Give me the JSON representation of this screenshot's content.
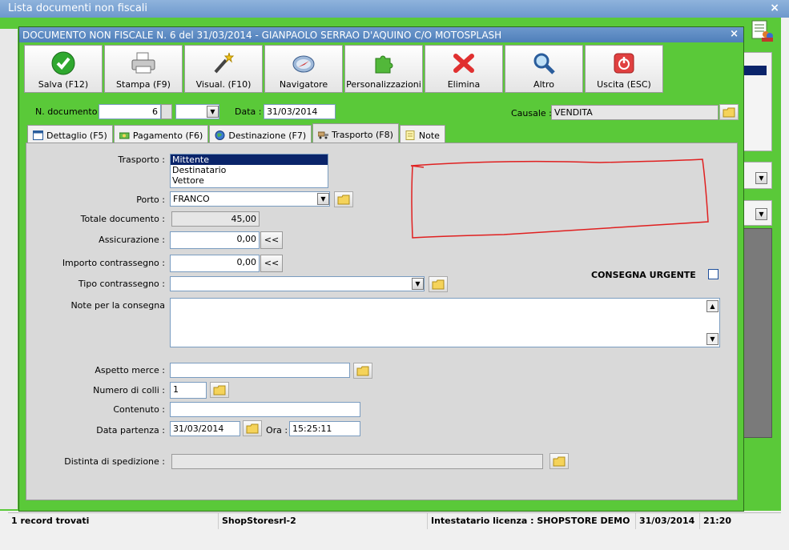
{
  "outer_window": {
    "title": "Lista documenti non fiscali",
    "close_glyph": "×"
  },
  "inner_window": {
    "title": "DOCUMENTO NON FISCALE N. 6 del 31/03/2014 - GIANPAOLO SERRAO D'AQUINO C/O MOTOSPLASH",
    "close_glyph": "×"
  },
  "toolbar": [
    {
      "label": "Salva (F12)",
      "icon": "check-icon"
    },
    {
      "label": "Stampa (F9)",
      "icon": "printer-icon"
    },
    {
      "label": "Visual. (F10)",
      "icon": "magic-wand-icon"
    },
    {
      "label": "Navigatore",
      "icon": "compass-icon"
    },
    {
      "label": "Personalizzazioni",
      "icon": "puzzle-icon"
    },
    {
      "label": "Elimina",
      "icon": "delete-x-icon"
    },
    {
      "label": "Altro",
      "icon": "magnifier-icon"
    },
    {
      "label": "Uscita (ESC)",
      "icon": "power-icon"
    }
  ],
  "header": {
    "ndoc_label": "N. documento :",
    "ndoc_value": "6",
    "data_label": "Data :",
    "data_value": "31/03/2014",
    "causale_label": "Causale :",
    "causale_value": "VENDITA"
  },
  "tabs": [
    {
      "label": "Dettaglio (F5)",
      "active": false
    },
    {
      "label": "Pagamento (F6)",
      "active": false
    },
    {
      "label": "Destinazione (F7)",
      "active": false
    },
    {
      "label": "Trasporto (F8)",
      "active": true
    },
    {
      "label": "Note",
      "active": false
    }
  ],
  "trasporto": {
    "trasporto_label": "Trasporto :",
    "trasporto_options": [
      "Mittente",
      "Destinatario",
      "Vettore"
    ],
    "trasporto_selected": "Mittente",
    "porto_label": "Porto :",
    "porto_value": "FRANCO",
    "totale_label": "Totale documento :",
    "totale_value": "45,00",
    "assicurazione_label": "Assicurazione :",
    "assicurazione_value": "0,00",
    "contrassegno_label": "Importo contrassegno :",
    "contrassegno_value": "0,00",
    "copy_button": "<<",
    "tipo_contrassegno_label": "Tipo contrassegno :",
    "tipo_contrassegno_value": "",
    "consegna_urgente_label": "CONSEGNA URGENTE",
    "consegna_urgente_checked": false,
    "note_label": "Note per la consegna",
    "note_value": "",
    "aspetto_label": "Aspetto merce :",
    "aspetto_value": "",
    "colli_label": "Numero di colli :",
    "colli_value": "1",
    "contenuto_label": "Contenuto :",
    "contenuto_value": "",
    "data_partenza_label": "Data partenza :",
    "data_partenza_value": "31/03/2014",
    "ora_label": "Ora :",
    "ora_value": "15:25:11",
    "distinta_label": "Distinta di spedizione :",
    "distinta_value": ""
  },
  "statusbar": {
    "records": "1 record trovati",
    "company": "ShopStoresrl-2",
    "licence": "Intestatario licenza : SHOPSTORE DEMO",
    "date": "31/03/2014",
    "time": "21:20"
  },
  "colors": {
    "window_green": "#5ac939",
    "title_blue": "#4f7fba",
    "annotation_red": "#e02020"
  }
}
